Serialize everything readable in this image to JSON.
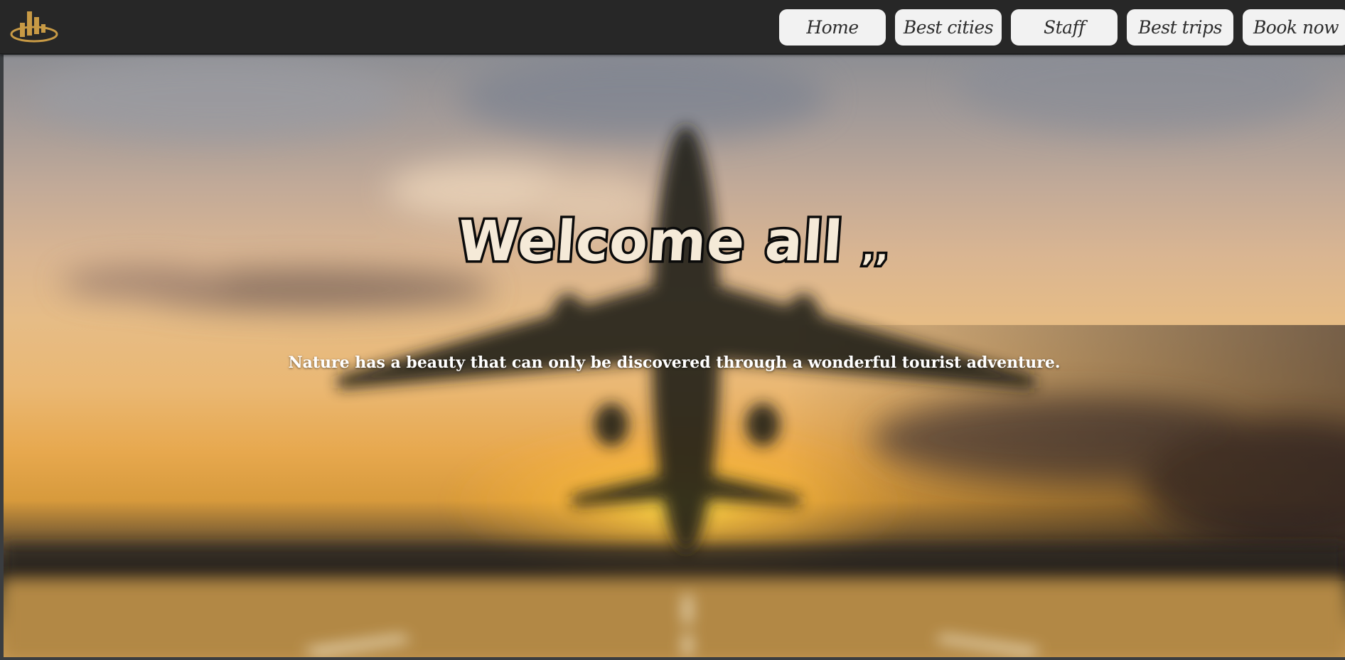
{
  "nav": {
    "items": [
      {
        "label": "Home"
      },
      {
        "label": "Best cities"
      },
      {
        "label": "Staff"
      },
      {
        "label": "Best trips"
      },
      {
        "label": "Book now"
      }
    ]
  },
  "hero": {
    "title": "Welcome all",
    "title_tail": ",,",
    "subtitle": "Nature has a beauty that can only be discovered through a wonderful tourist adventure."
  },
  "colors": {
    "navbar": "#272727",
    "nav_button": "#f2f2f2",
    "logo": "#c89a45"
  },
  "icons": {
    "logo": "buildings-logo-icon"
  }
}
